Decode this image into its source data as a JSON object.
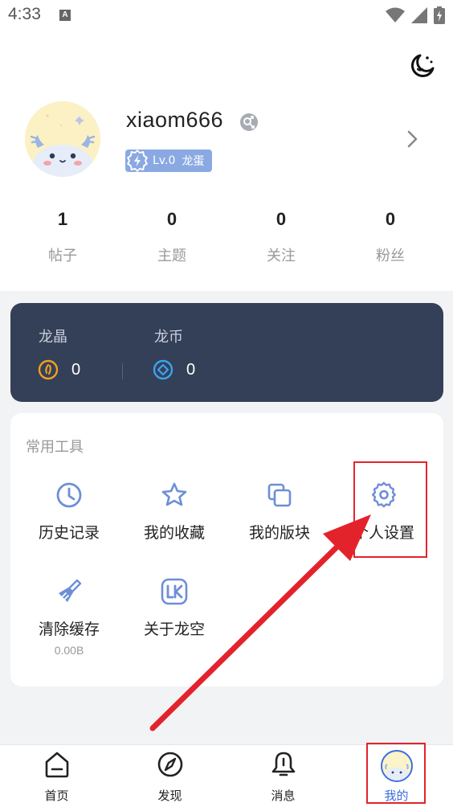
{
  "status_bar": {
    "time": "4:33",
    "notification_badge": "A",
    "icons": [
      "wifi-icon",
      "signal-icon",
      "battery-icon"
    ]
  },
  "profile": {
    "username": "xiaom666",
    "level": "Lv.0",
    "level_title": "龙蛋"
  },
  "stats": [
    {
      "value": "1",
      "label": "帖子"
    },
    {
      "value": "0",
      "label": "主题"
    },
    {
      "value": "0",
      "label": "关注"
    },
    {
      "value": "0",
      "label": "粉丝"
    }
  ],
  "currency": [
    {
      "label": "龙晶",
      "value": "0",
      "icon": "dragon-crystal-icon",
      "color": "#f0a020"
    },
    {
      "label": "龙币",
      "value": "0",
      "icon": "dragon-coin-icon",
      "color": "#3aa3f0"
    }
  ],
  "tools": {
    "title": "常用工具",
    "items": [
      {
        "label": "历史记录",
        "icon": "clock-icon"
      },
      {
        "label": "我的收藏",
        "icon": "star-icon"
      },
      {
        "label": "我的版块",
        "icon": "boards-icon"
      },
      {
        "label": "个人设置",
        "icon": "gear-icon"
      },
      {
        "label": "清除缓存",
        "sub": "0.00B",
        "icon": "broom-icon"
      },
      {
        "label": "关于龙空",
        "icon": "lk-logo-icon"
      }
    ]
  },
  "bottom_nav": [
    {
      "label": "首页",
      "icon": "home-icon"
    },
    {
      "label": "发现",
      "icon": "compass-icon"
    },
    {
      "label": "消息",
      "icon": "bell-icon"
    },
    {
      "label": "我的",
      "icon": "avatar-icon",
      "active": true
    }
  ],
  "colors": {
    "accent": "#3b6fe0",
    "card_dark": "#344058",
    "icon_blue": "#6e8ed6",
    "annotation_red": "#e3232c"
  }
}
